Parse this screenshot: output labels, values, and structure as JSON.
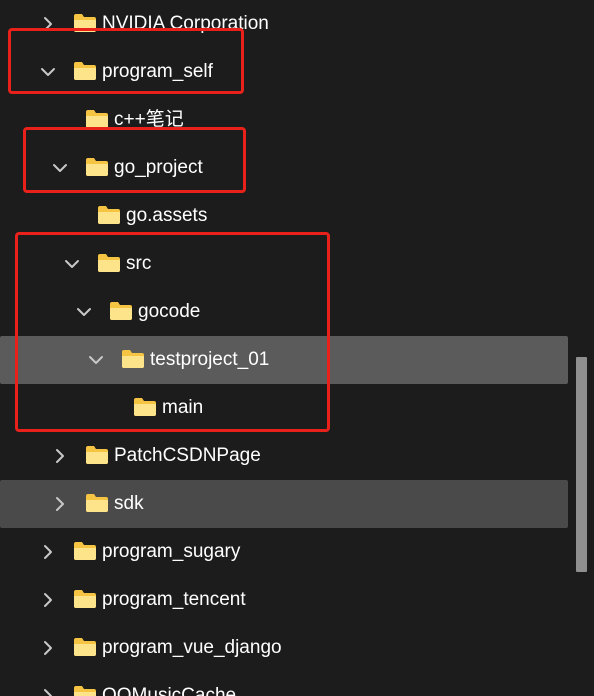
{
  "tree": {
    "rows": [
      {
        "label": "NVIDIA Corporation",
        "expanded": false,
        "has_children": true,
        "state": "normal"
      },
      {
        "label": "program_self",
        "expanded": true,
        "has_children": true,
        "state": "normal"
      },
      {
        "label": "c++笔记",
        "expanded": false,
        "has_children": false,
        "state": "normal"
      },
      {
        "label": "go_project",
        "expanded": true,
        "has_children": true,
        "state": "normal"
      },
      {
        "label": "go.assets",
        "expanded": false,
        "has_children": false,
        "state": "normal"
      },
      {
        "label": "src",
        "expanded": true,
        "has_children": true,
        "state": "normal"
      },
      {
        "label": "gocode",
        "expanded": true,
        "has_children": true,
        "state": "normal"
      },
      {
        "label": "testproject_01",
        "expanded": true,
        "has_children": true,
        "state": "selected"
      },
      {
        "label": "main",
        "expanded": false,
        "has_children": false,
        "state": "normal"
      },
      {
        "label": "PatchCSDNPage",
        "expanded": false,
        "has_children": true,
        "state": "normal"
      },
      {
        "label": "sdk",
        "expanded": false,
        "has_children": true,
        "state": "hovered"
      },
      {
        "label": "program_sugary",
        "expanded": false,
        "has_children": true,
        "state": "normal"
      },
      {
        "label": "program_tencent",
        "expanded": false,
        "has_children": true,
        "state": "normal"
      },
      {
        "label": "program_vue_django",
        "expanded": false,
        "has_children": true,
        "state": "normal"
      },
      {
        "label": "QQMusicCache",
        "expanded": false,
        "has_children": true,
        "state": "normal"
      }
    ]
  },
  "icons": {
    "expanded": "chevron-down-icon",
    "collapsed": "chevron-right-icon",
    "folder": "folder-icon"
  },
  "colors": {
    "background": "#1c1c1c",
    "selected_row": "#5b5b5b",
    "hover_row": "#4a4a4a",
    "folder_body": "#f6c443",
    "folder_front": "#fde38a",
    "annotation": "#e8221b",
    "text": "#ffffff",
    "chevron": "#c8c8c8",
    "scrollbar": "#8f8f8f"
  }
}
